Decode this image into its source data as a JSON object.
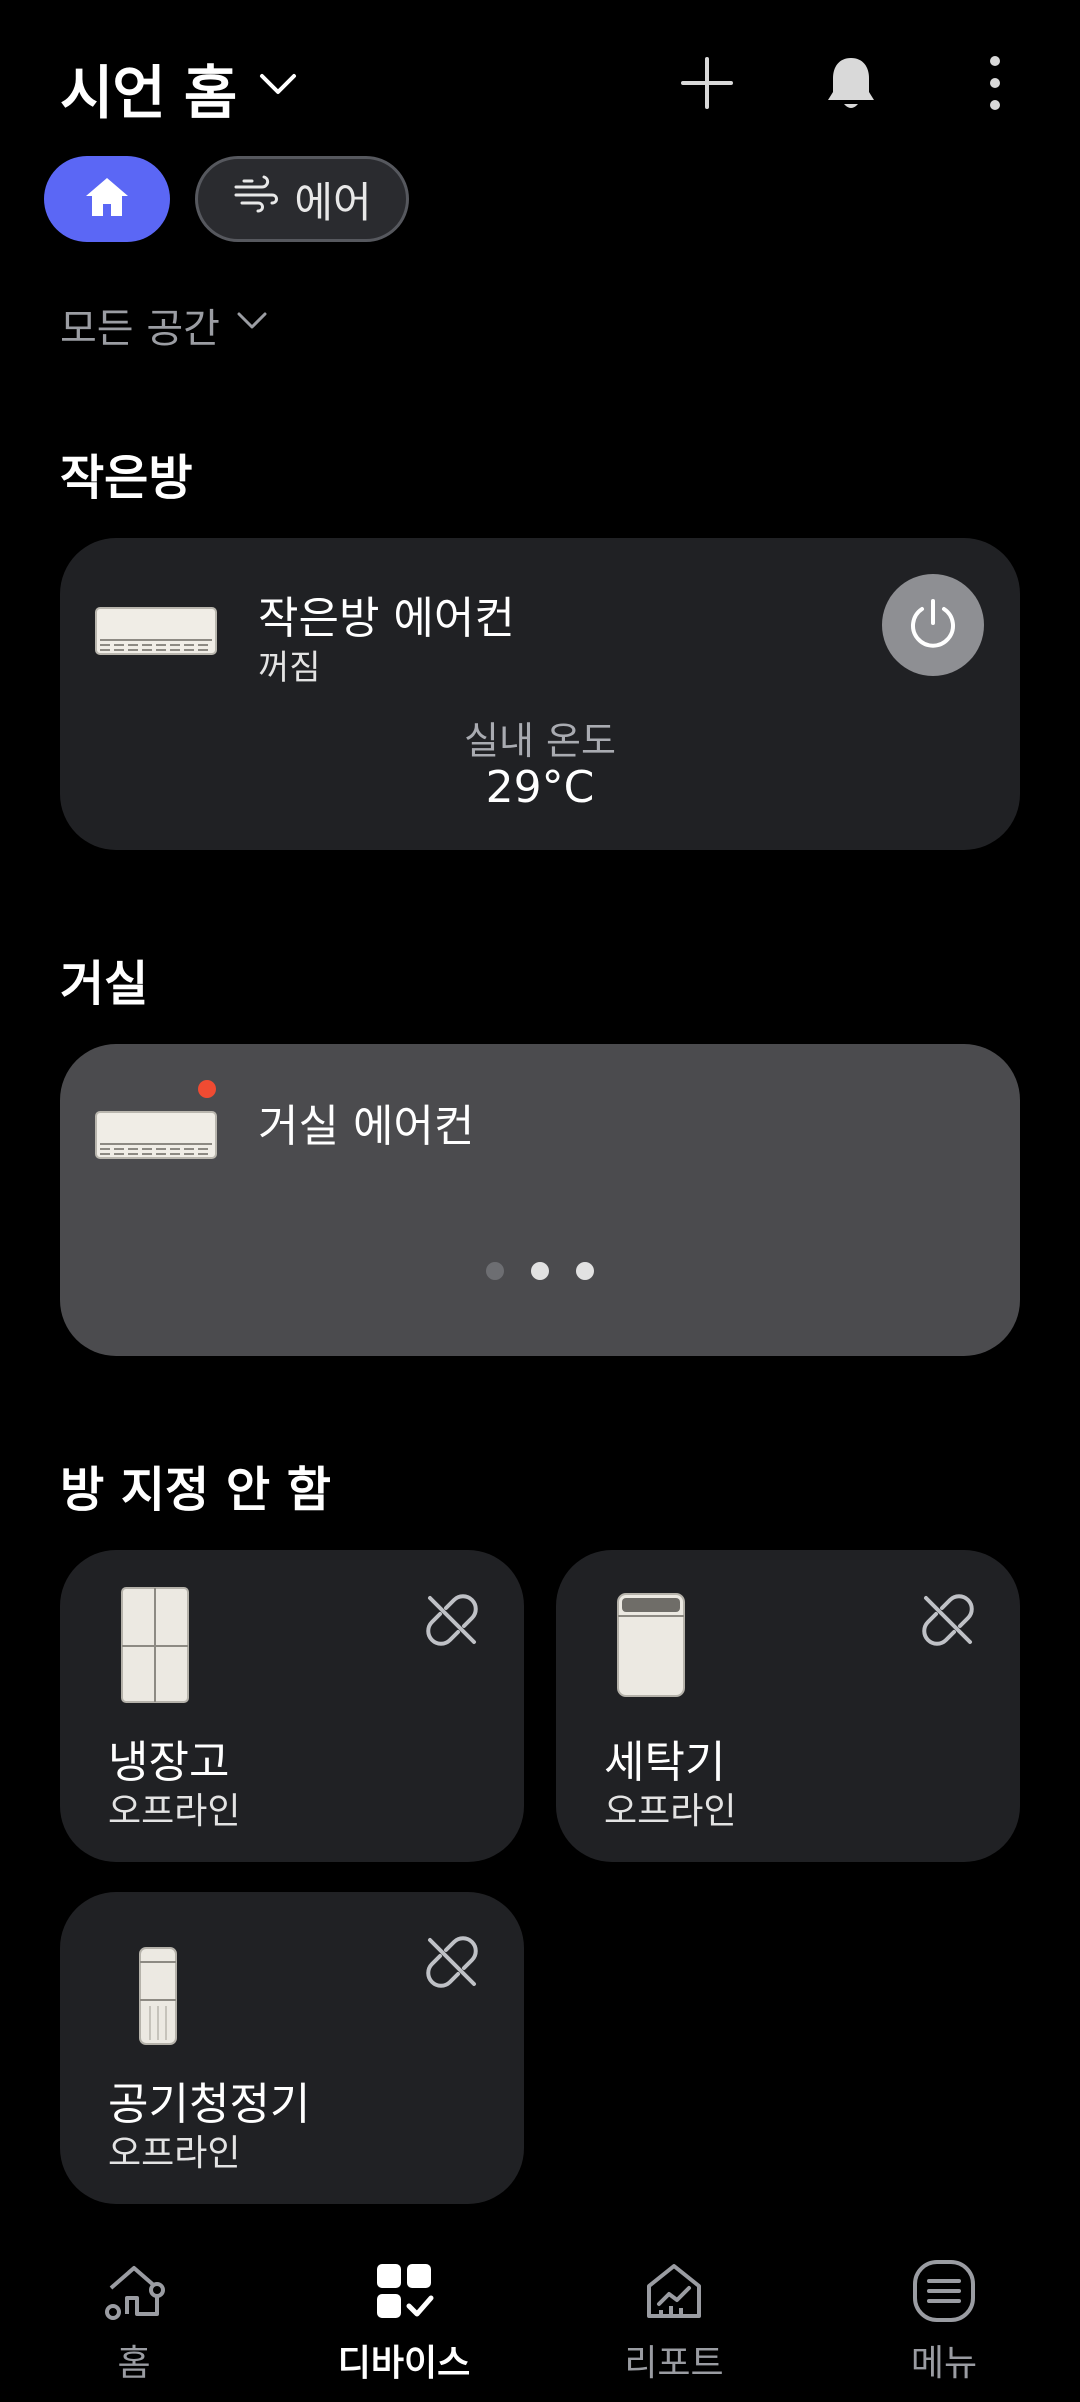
{
  "header": {
    "title": "시언 홈",
    "icons": [
      "chevron-down-icon",
      "plus-icon",
      "bell-icon",
      "more-vertical-icon"
    ]
  },
  "chips": {
    "home_icon": "home-icon",
    "air_label": "에어",
    "air_icon": "wind-icon"
  },
  "filter": {
    "label": "모든 공간"
  },
  "sections": {
    "small_room": "작은방",
    "living_room": "거실",
    "unassigned": "방 지정 안 함"
  },
  "devices": {
    "small_room_ac": {
      "name": "작은방 에어컨",
      "status": "꺼짐",
      "temp_label": "실내 온도",
      "temp_value": "29°C"
    },
    "living_room_ac": {
      "name": "거실 에어컨"
    },
    "fridge": {
      "name": "냉장고",
      "status": "오프라인"
    },
    "washer": {
      "name": "세탁기",
      "status": "오프라인"
    },
    "purifier": {
      "name": "공기청정기",
      "status": "오프라인"
    }
  },
  "bottom_nav": {
    "items": [
      {
        "label": "홈",
        "icon": "home-outline-icon"
      },
      {
        "label": "디바이스",
        "icon": "devices-icon"
      },
      {
        "label": "리포트",
        "icon": "report-icon"
      },
      {
        "label": "메뉴",
        "icon": "menu-icon"
      }
    ],
    "active_index": 1
  },
  "colors": {
    "accent": "#5b67f5",
    "notification_dot": "#f04b32",
    "card_dark": "#202124",
    "card_gray": "#4b4b4e"
  }
}
